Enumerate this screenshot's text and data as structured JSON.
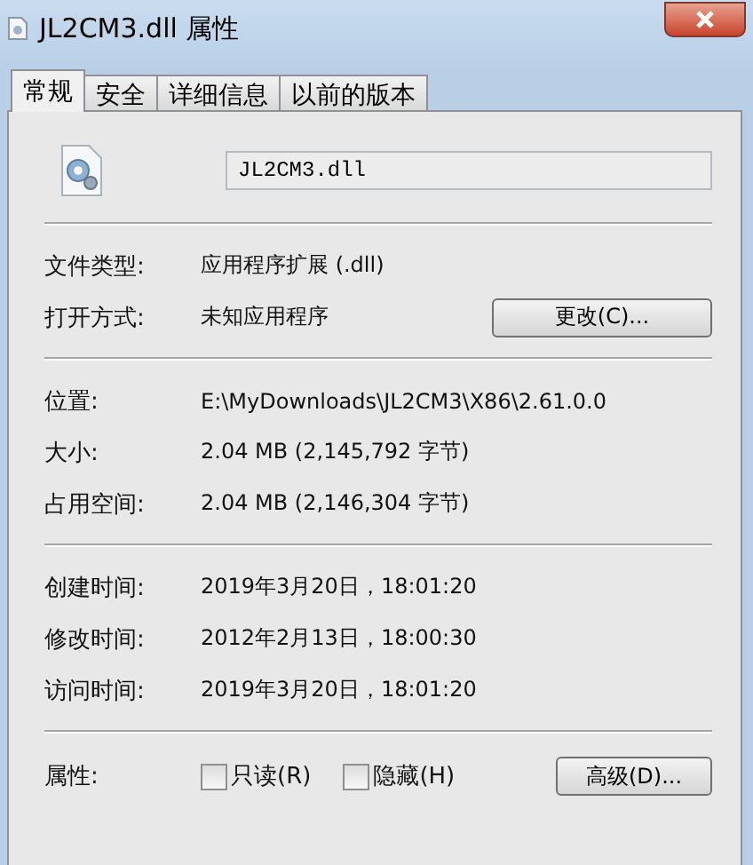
{
  "window": {
    "title": "JL2CM3.dll 属性"
  },
  "tabs": [
    {
      "label": "常规",
      "selected": true
    },
    {
      "label": "安全",
      "selected": false
    },
    {
      "label": "详细信息",
      "selected": false
    },
    {
      "label": "以前的版本",
      "selected": false
    }
  ],
  "file_name": {
    "value": "JL2CM3.dll"
  },
  "type_section": [
    {
      "label": "文件类型:",
      "value": "应用程序扩展 (.dll)"
    },
    {
      "label": "打开方式:",
      "value": "未知应用程序",
      "button": "更改(C)..."
    }
  ],
  "location_section": [
    {
      "label": "位置:",
      "value": "E:\\MyDownloads\\JL2CM3\\X86\\2.61.0.0"
    },
    {
      "label": "大小:",
      "value": "2.04 MB (2,145,792 字节)"
    },
    {
      "label": "占用空间:",
      "value": "2.04 MB (2,146,304 字节)"
    }
  ],
  "time_section": [
    {
      "label": "创建时间:",
      "value": "2019年3月20日，18:01:20"
    },
    {
      "label": "修改时间:",
      "value": "2012年2月13日，18:00:30"
    },
    {
      "label": "访问时间:",
      "value": "2019年3月20日，18:01:20"
    }
  ],
  "attributes": {
    "label": "属性:",
    "checkboxes": [
      {
        "label": "只读(R)",
        "checked": false
      },
      {
        "label": "隐藏(H)",
        "checked": false
      }
    ],
    "button": "高级(D)..."
  }
}
